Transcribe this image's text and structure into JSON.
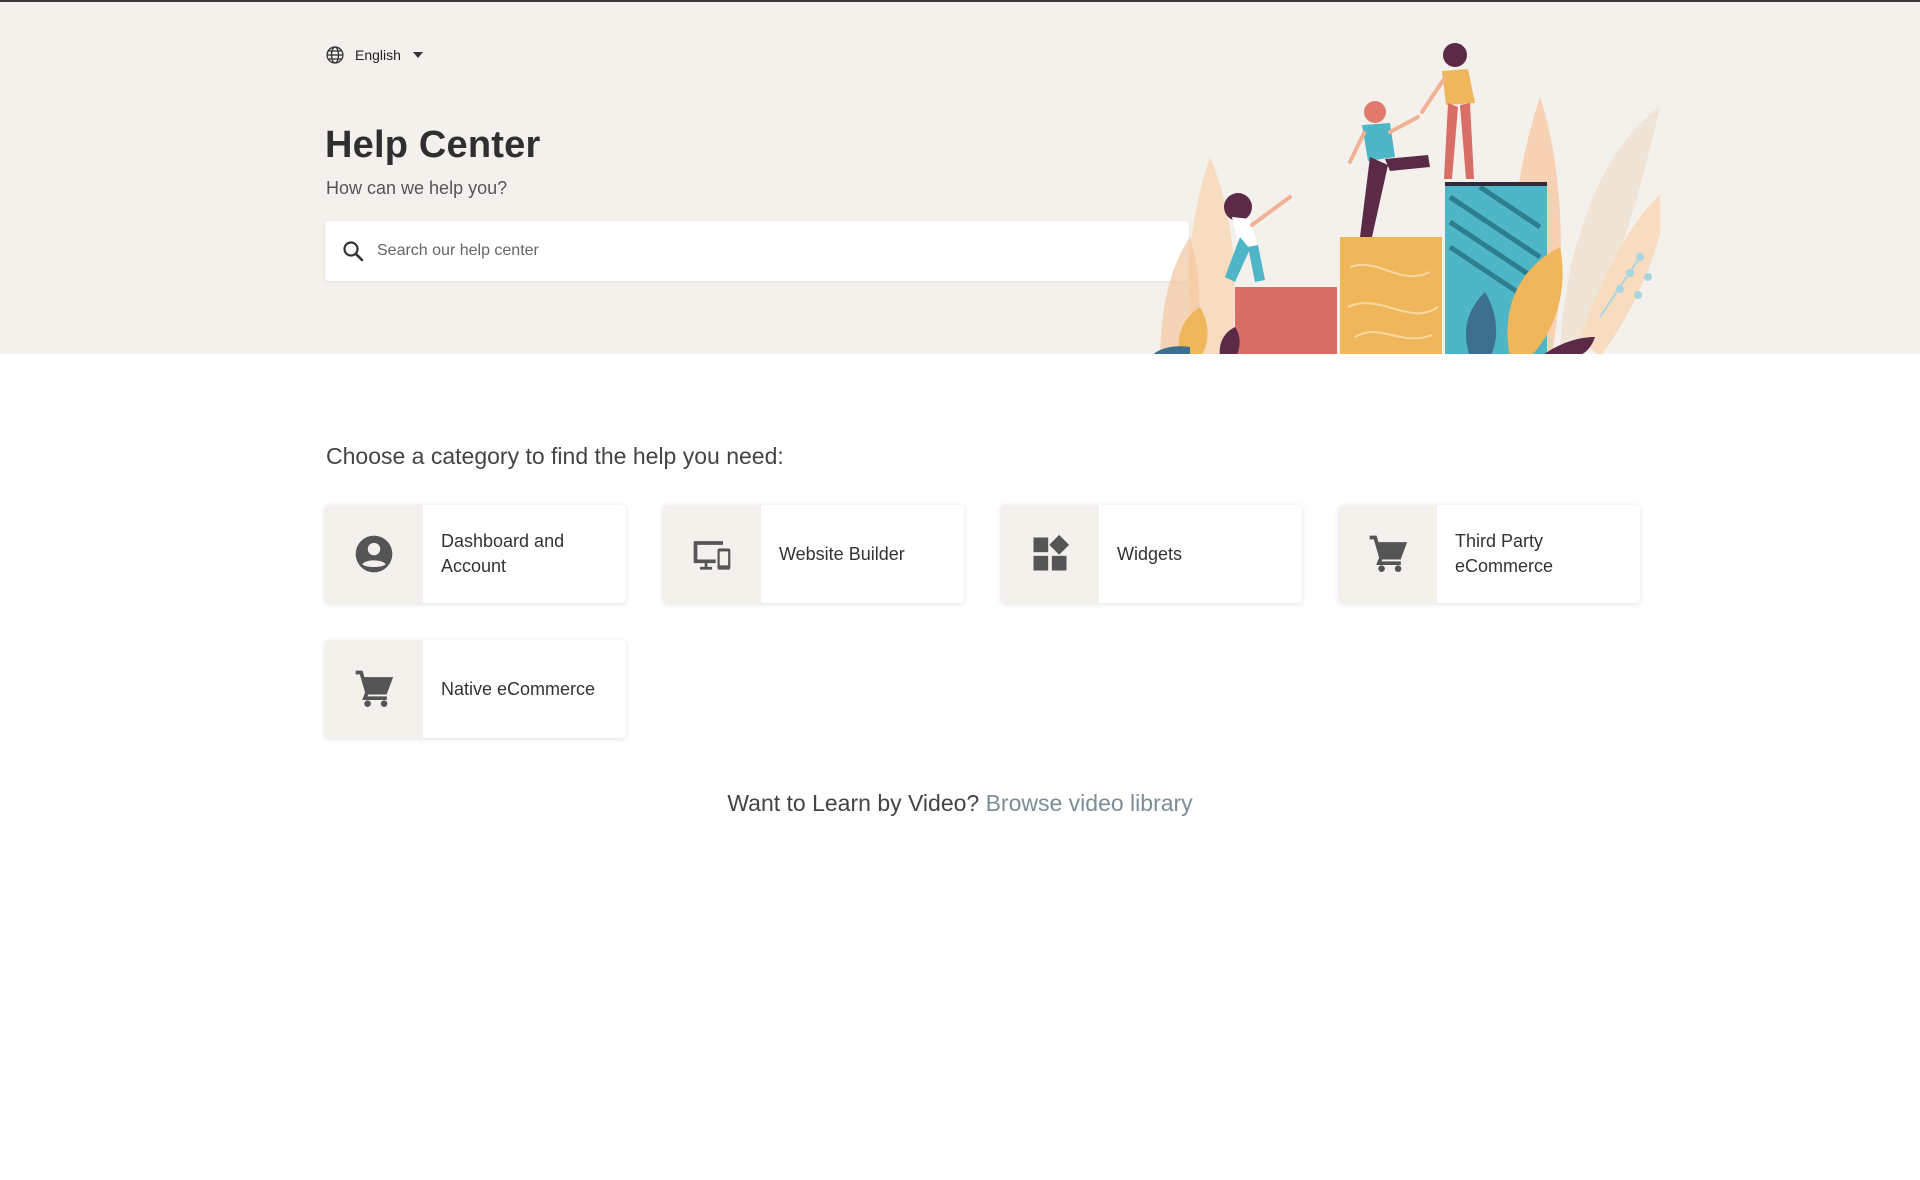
{
  "language": {
    "selected": "English",
    "icon": "globe-icon"
  },
  "hero": {
    "title": "Help Center",
    "subtitle": "How can we help you?",
    "search_placeholder": "Search our help center"
  },
  "categories_heading": "Choose a category to find the help you need:",
  "categories": [
    {
      "label": "Dashboard and Account",
      "icon": "account-circle-icon"
    },
    {
      "label": "Website Builder",
      "icon": "devices-icon"
    },
    {
      "label": "Widgets",
      "icon": "widgets-icon"
    },
    {
      "label": "Third Party eCommerce",
      "icon": "shopping-cart-icon"
    },
    {
      "label": "Native eCommerce",
      "icon": "shopping-cart-icon"
    }
  ],
  "video": {
    "prompt": "Want to Learn by Video?",
    "link_label": "Browse video library"
  },
  "colors": {
    "hero_bg": "#f4f1ec",
    "icon": "#555555",
    "link": "#7b8d97"
  }
}
